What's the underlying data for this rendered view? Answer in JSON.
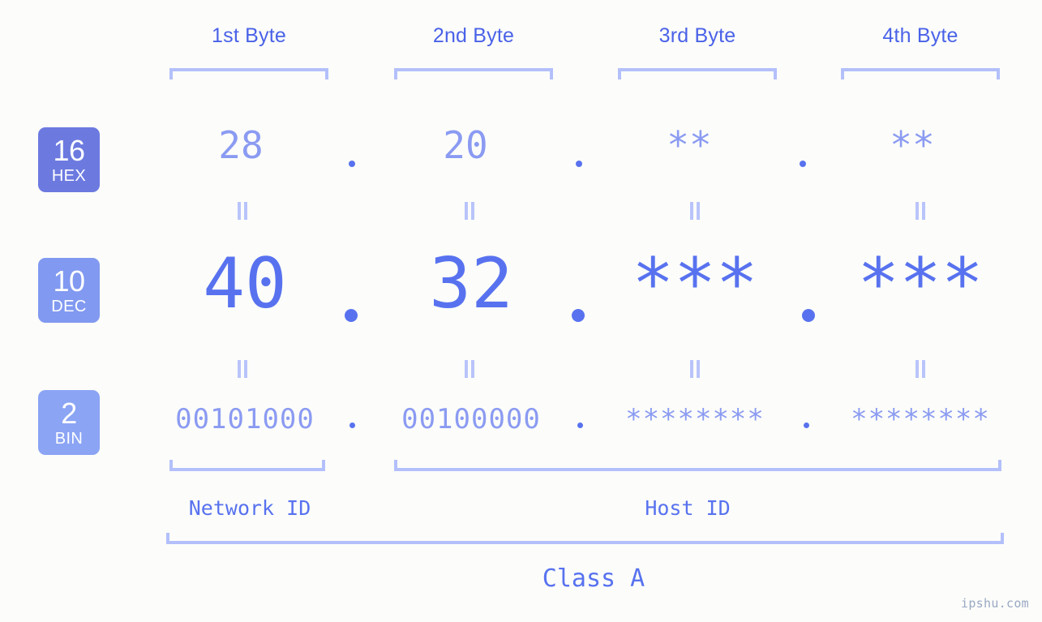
{
  "meta": {
    "watermark": "ipshu.com"
  },
  "colors": {
    "background": "#fcfdfa",
    "accent_strong": "#5872ef",
    "accent_mid": "#6c7ae0",
    "accent_light": "#8b9bf2",
    "bracket": "#b3c0fb",
    "heading": "#4a62e8"
  },
  "byte_headers": [
    {
      "label": "1st Byte"
    },
    {
      "label": "2nd Byte"
    },
    {
      "label": "3rd Byte"
    },
    {
      "label": "4th Byte"
    }
  ],
  "bases": [
    {
      "num": "16",
      "name": "HEX",
      "color": "#6c7ae0"
    },
    {
      "num": "10",
      "name": "DEC",
      "color": "#8199f0"
    },
    {
      "num": "2",
      "name": "BIN",
      "color": "#8ba4f4"
    }
  ],
  "rows": {
    "hex": {
      "base_num": "16",
      "base_name": "HEX",
      "values": [
        "28",
        "20",
        "**",
        "**"
      ],
      "separators": [
        ".",
        ".",
        "."
      ]
    },
    "dec": {
      "base_num": "10",
      "base_name": "DEC",
      "values": [
        "40",
        "32",
        "***",
        "***"
      ],
      "separators": [
        ".",
        ".",
        "."
      ]
    },
    "bin": {
      "base_num": "2",
      "base_name": "BIN",
      "values": [
        "00101000",
        "00100000",
        "********",
        "********"
      ],
      "separators": [
        ".",
        ".",
        "."
      ]
    }
  },
  "equality_marks": {
    "symbol": "=",
    "count_per_row_gap": 4
  },
  "segments": {
    "network_id": {
      "label": "Network ID",
      "spans_bytes": "1"
    },
    "host_id": {
      "label": "Host ID",
      "spans_bytes": "2-4"
    },
    "class": {
      "label": "Class A",
      "spans_bytes": "1-4"
    }
  }
}
